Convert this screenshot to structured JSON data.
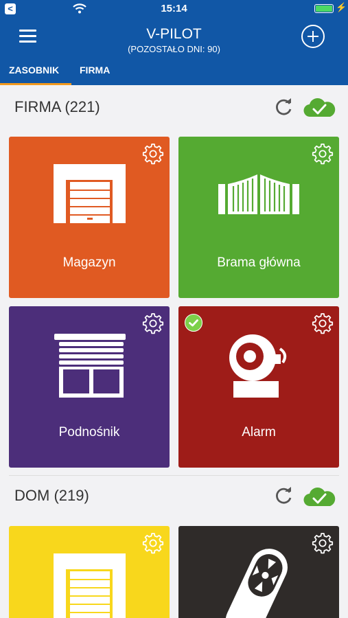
{
  "status_bar": {
    "time": "15:14"
  },
  "header": {
    "title": "V-PILOT",
    "subtitle": "(POZOSTAŁO DNI: 90)",
    "tabs": [
      {
        "label": "ZASOBNIK",
        "active": true
      },
      {
        "label": "FIRMA",
        "active": false
      }
    ]
  },
  "sections": [
    {
      "title": "FIRMA (221)",
      "tiles": [
        {
          "label": "Magazyn",
          "color": "#e05a22",
          "icon": "garage-door-icon"
        },
        {
          "label": "Brama główna",
          "color": "#55aa32",
          "icon": "gate-icon"
        },
        {
          "label": "Podnośnik",
          "color": "#4c2e7a",
          "icon": "window-blind-icon"
        },
        {
          "label": "Alarm",
          "color": "#9e1c18",
          "icon": "alarm-bell-icon",
          "selected": true
        }
      ]
    },
    {
      "title": "DOM (219)",
      "tiles": [
        {
          "label": "",
          "color": "#f8d71c",
          "icon": "garage-door-icon"
        },
        {
          "label": "",
          "color": "#2f2b29",
          "icon": "remote-control-icon"
        }
      ]
    }
  ],
  "colors": {
    "app_bar": "#1157a6",
    "tab_indicator": "#f39a1e",
    "sync_ok": "#55aa32"
  }
}
